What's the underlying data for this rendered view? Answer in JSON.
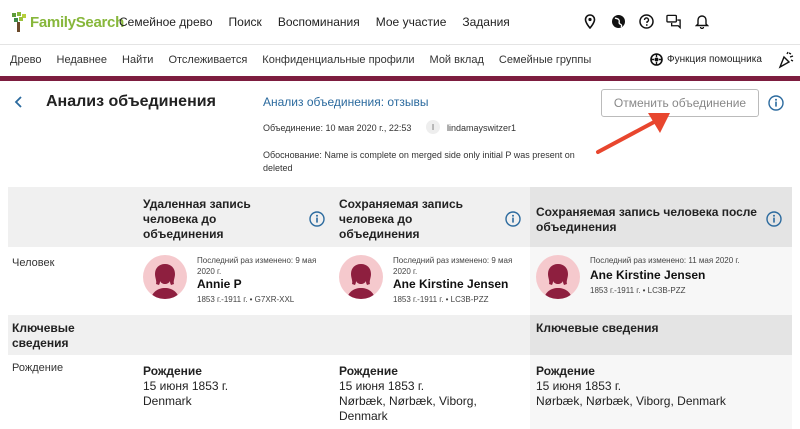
{
  "brand": {
    "logo_text": "FamilySearch",
    "color": "#87b73b"
  },
  "topnav": {
    "items": [
      "Семейное древо",
      "Поиск",
      "Воспоминания",
      "Мое участие",
      "Задания"
    ]
  },
  "top_icons": [
    "location-icon",
    "globe-icon",
    "help-icon",
    "chat-icon",
    "bell-icon"
  ],
  "subnav": {
    "items": [
      "Древо",
      "Недавнее",
      "Найти",
      "Отслеживается",
      "Конфиденциальные профили",
      "Мой вклад",
      "Семейные группы"
    ]
  },
  "assistant": {
    "label": "Функция помощника"
  },
  "header": {
    "title": "Анализ объединения",
    "review_link": "Анализ объединения: отзывы",
    "undo_button": "Отменить объединение",
    "merge_date": "Объединение: 10 мая 2020 г., 22:53",
    "user_initial": "l",
    "username": "lindamayswitzer1",
    "reason": "Обоснование: Name is complete on merged side only initial P was present on deleted"
  },
  "table": {
    "columns": [
      "Удаленная запись человека до объединения",
      "Сохраняемая запись человека до объединения",
      "Сохраняемая запись человека после объединения"
    ],
    "person_label": "Человек",
    "persons": [
      {
        "modified": "Последний раз изменено: 9 мая 2020 г.",
        "name": "Annie P",
        "life": "1853 г.-1911 г. • G7XR-XXL"
      },
      {
        "modified": "Последний раз изменено: 9 мая 2020 г.",
        "name": "Ane Kirstine Jensen",
        "life": "1853 г.-1911 г. • LC3B-PZZ"
      },
      {
        "modified": "Последний раз изменено: 11 мая 2020 г.",
        "name": "Ane Kirstine Jensen",
        "life": "1853 г.-1911 г. • LC3B-PZZ"
      }
    ],
    "key_facts_label": "Ключевые сведения",
    "key_facts_label_after": "Ключевые сведения",
    "birth_label": "Рождение",
    "births": [
      {
        "title": "Рождение",
        "date": "15 июня 1853 г.",
        "place": "Denmark"
      },
      {
        "title": "Рождение",
        "date": "15 июня 1853 г.",
        "place": "Nørbæk, Nørbæk, Viborg, Denmark"
      },
      {
        "title": "Рождение",
        "date": "15 июня 1853 г.",
        "place": "Nørbæk, Nørbæk, Viborg, Denmark"
      }
    ]
  },
  "colors": {
    "accent_bar": "#7d1d3f",
    "link": "#2b6a9e",
    "arrow": "#e8462e",
    "avatar_bg": "#f5c9cd",
    "avatar_fg": "#8e1f3f"
  }
}
